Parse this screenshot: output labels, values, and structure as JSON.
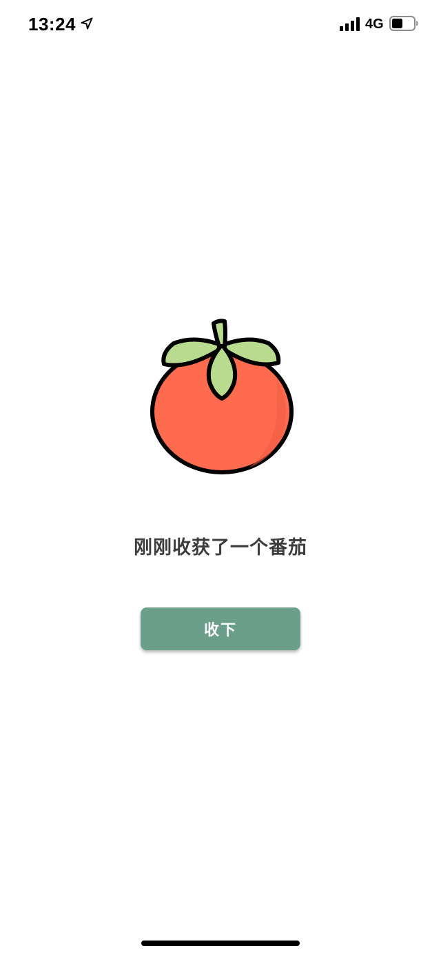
{
  "status_bar": {
    "time": "13:24",
    "network": "4G",
    "icons": [
      "location-arrow-icon",
      "cellular-signal-icon",
      "battery-icon"
    ]
  },
  "main": {
    "illustration": "tomato-icon",
    "message": "刚刚收获了一个番茄",
    "accept_button_label": "收下"
  },
  "colors": {
    "tomato_body": "#ff6b4f",
    "tomato_leaves": "#b8db8f",
    "button": "#6c9f8b",
    "text": "#3d3d3d"
  }
}
